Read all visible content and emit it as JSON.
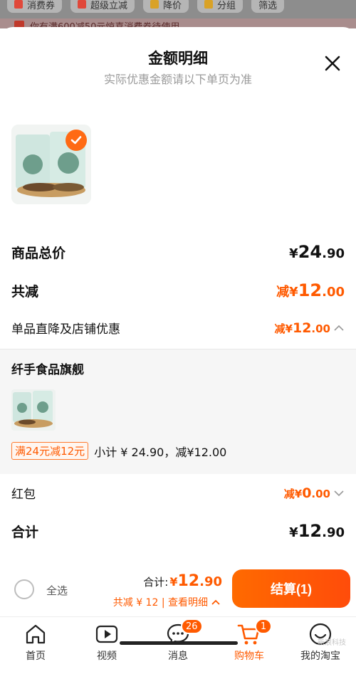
{
  "background": {
    "chips": [
      "消费券",
      "超级立减",
      "降价",
      "分组",
      "筛选"
    ],
    "promo_text": "你有满600减50元惊喜消费券待使用"
  },
  "sheet": {
    "title": "金额明细",
    "subtitle": "实际优惠金额请以下单页为准"
  },
  "summary": {
    "goods_total_label": "商品总价",
    "goods_total_currency": "¥",
    "goods_total_int": "24",
    "goods_total_dec": ".90",
    "reduced_label": "共减",
    "reduced_prefix": "减¥",
    "reduced_int": "12",
    "reduced_dec": ".00",
    "item_discount_label": "单品直降及店铺优惠",
    "item_discount_prefix": "减¥",
    "item_discount_int": "12",
    "item_discount_dec": ".00"
  },
  "store": {
    "name": "纤手食品旗舰",
    "promo_tag": "满24元减12元",
    "subtotal_text": "小计 ¥ 24.90，减¥12.00"
  },
  "red_packet": {
    "label": "红包",
    "prefix": "减¥",
    "int": "0",
    "dec": ".00"
  },
  "grand_total": {
    "label": "合计",
    "currency": "¥",
    "int": "12",
    "dec": ".90"
  },
  "footer": {
    "select_all": "全选",
    "total_label": "合计:",
    "total_currency": "¥",
    "total_int": "12",
    "total_dec": ".90",
    "savings_text": "共减 ¥ 12 | 查看明细",
    "checkout_label": "结算(1)"
  },
  "tabbar": {
    "tabs": [
      {
        "label": "首页",
        "icon": "home-icon"
      },
      {
        "label": "视频",
        "icon": "video-icon"
      },
      {
        "label": "消息",
        "icon": "message-icon",
        "badge": "26"
      },
      {
        "label": "购物车",
        "icon": "cart-icon",
        "badge": "1",
        "active": true
      },
      {
        "label": "我的淘宝",
        "icon": "profile-icon"
      }
    ]
  },
  "watermark": "新浪科技",
  "colors": {
    "accent": "#ff5a00",
    "checkout_start": "#ff6a00",
    "checkout_end": "#ff4c0a"
  }
}
